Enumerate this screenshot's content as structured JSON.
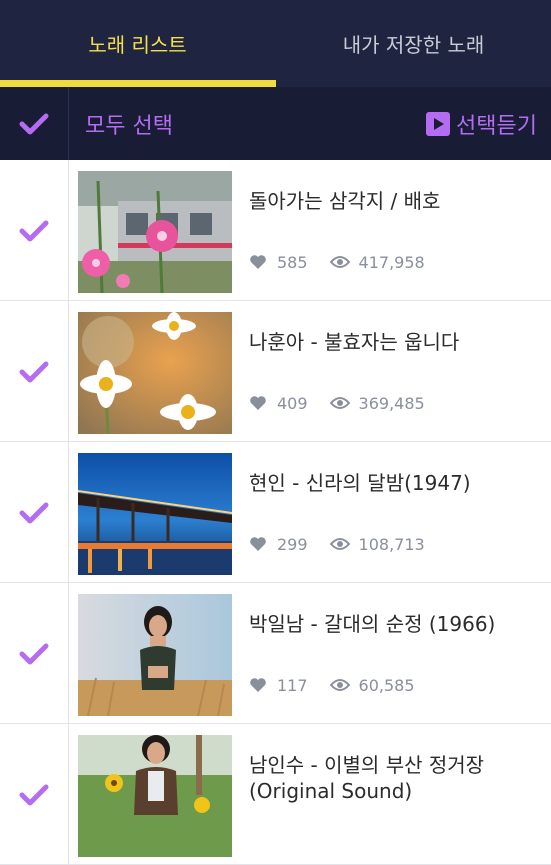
{
  "tabs": [
    {
      "label": "노래 리스트",
      "active": true
    },
    {
      "label": "내가 저장한 노래",
      "active": false
    }
  ],
  "select_bar": {
    "select_all_label": "모두 선택",
    "play_selected_label": "선택듣기"
  },
  "colors": {
    "accent_purple": "#b46cf2",
    "tab_active_yellow": "#f5e04a",
    "header_navy": "#1f2540"
  },
  "songs": [
    {
      "title": "돌아가는 삼각지 / 배호",
      "likes": "585",
      "views": "417,958",
      "thumbnail": "pink flowers in front of a train"
    },
    {
      "title": "나훈아 - 불효자는 웁니다",
      "likes": "409",
      "views": "369,485",
      "thumbnail": "white daisies"
    },
    {
      "title": "현인 - 신라의 달밤(1947)",
      "likes": "299",
      "views": "108,713",
      "thumbnail": "lit bridge over river at night"
    },
    {
      "title": "박일남 - 갈대의 순정 (1966)",
      "likes": "117",
      "views": "60,585",
      "thumbnail": "woman in a reed field"
    },
    {
      "title": "남인수 - 이별의 부산 정거장 (Original Sound)",
      "likes": "",
      "views": "",
      "thumbnail": "woman with sunflowers"
    }
  ]
}
